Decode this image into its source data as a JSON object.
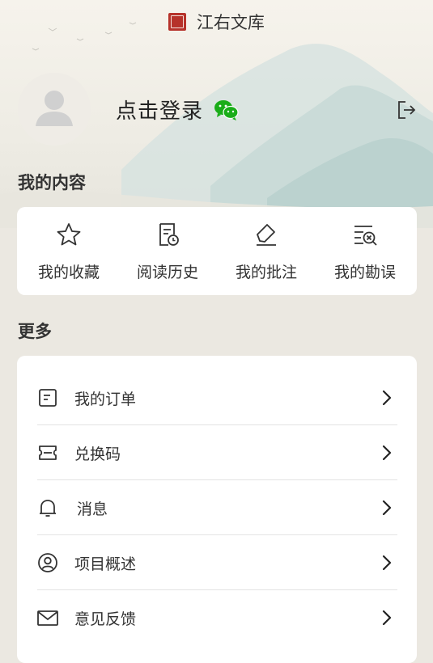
{
  "app": {
    "title": "江右文库"
  },
  "profile": {
    "login_text": "点击登录"
  },
  "sections": {
    "my_content": "我的内容",
    "more": "更多"
  },
  "my_content_items": [
    {
      "label": "我的收藏",
      "icon": "star-icon"
    },
    {
      "label": "阅读历史",
      "icon": "history-icon"
    },
    {
      "label": "我的批注",
      "icon": "annotate-icon"
    },
    {
      "label": "我的勘误",
      "icon": "correction-icon"
    }
  ],
  "menu": [
    {
      "label": "我的订单",
      "icon": "order-icon"
    },
    {
      "label": "兑换码",
      "icon": "ticket-icon"
    },
    {
      "label": "消息",
      "icon": "bell-icon"
    },
    {
      "label": "项目概述",
      "icon": "user-circle-icon"
    },
    {
      "label": "意见反馈",
      "icon": "mail-icon"
    }
  ],
  "colors": {
    "accent_seal": "#b6322a",
    "wechat": "#1aad19"
  }
}
